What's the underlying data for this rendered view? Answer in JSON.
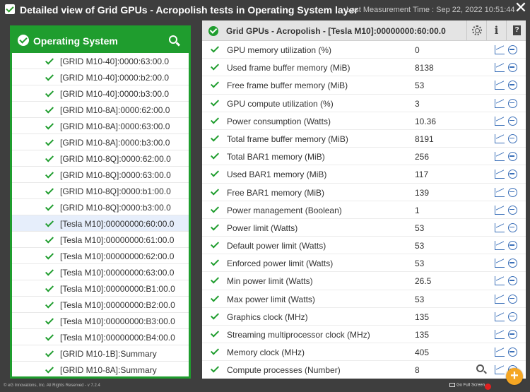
{
  "window": {
    "title": "Detailed view of Grid GPUs - Acropolish tests in Operating System layer",
    "last_measurement": "Last Measurement Time : Sep 22, 2022 10:51:44",
    "close_label": "✕"
  },
  "left_panel": {
    "title": "Operating System",
    "items": [
      {
        "label": "[GRID M10-40]:0000:63:00.0"
      },
      {
        "label": "[GRID M10-40]:0000:b2:00.0"
      },
      {
        "label": "[GRID M10-40]:0000:b3:00.0"
      },
      {
        "label": "[GRID M10-8A]:0000:62:00.0"
      },
      {
        "label": "[GRID M10-8A]:0000:63:00.0"
      },
      {
        "label": "[GRID M10-8A]:0000:b3:00.0"
      },
      {
        "label": "[GRID M10-8Q]:0000:62:00.0"
      },
      {
        "label": "[GRID M10-8Q]:0000:63:00.0"
      },
      {
        "label": "[GRID M10-8Q]:0000:b1:00.0"
      },
      {
        "label": "[GRID M10-8Q]:0000:b3:00.0"
      },
      {
        "label": "[Tesla M10]:00000000:60:00.0"
      },
      {
        "label": "[Tesla M10]:00000000:61:00.0"
      },
      {
        "label": "[Tesla M10]:00000000:62:00.0"
      },
      {
        "label": "[Tesla M10]:00000000:63:00.0"
      },
      {
        "label": "[Tesla M10]:00000000:B1:00.0"
      },
      {
        "label": "[Tesla M10]:00000000:B2:00.0"
      },
      {
        "label": "[Tesla M10]:00000000:B3:00.0"
      },
      {
        "label": "[Tesla M10]:00000000:B4:00.0"
      },
      {
        "label": "[GRID M10-1B]:Summary"
      },
      {
        "label": "[GRID M10-8A]:Summary"
      }
    ],
    "selected_index": 10
  },
  "right_panel": {
    "title": "Grid GPUs - Acropolish - [Tesla M10]:00000000:60:00.0",
    "info_label": "i",
    "help_label": "?",
    "rows": [
      {
        "name": "GPU memory utilization (%)",
        "value": "0"
      },
      {
        "name": "Used frame buffer memory (MiB)",
        "value": "8138"
      },
      {
        "name": "Free frame buffer memory (MiB)",
        "value": "53"
      },
      {
        "name": "GPU compute utilization (%)",
        "value": "3"
      },
      {
        "name": "Power consumption (Watts)",
        "value": "10.36"
      },
      {
        "name": "Total frame buffer memory (MiB)",
        "value": "8191"
      },
      {
        "name": "Total BAR1 memory (MiB)",
        "value": "256"
      },
      {
        "name": "Used BAR1 memory (MiB)",
        "value": "117"
      },
      {
        "name": "Free BAR1 memory (MiB)",
        "value": "139"
      },
      {
        "name": "Power management (Boolean)",
        "value": "1"
      },
      {
        "name": "Power limit (Watts)",
        "value": "53"
      },
      {
        "name": "Default power limit (Watts)",
        "value": "53"
      },
      {
        "name": "Enforced power limit (Watts)",
        "value": "53"
      },
      {
        "name": "Min power limit (Watts)",
        "value": "26.5"
      },
      {
        "name": "Max power limit (Watts)",
        "value": "53"
      },
      {
        "name": "Graphics clock (MHz)",
        "value": "135"
      },
      {
        "name": "Streaming multiprocessor clock (MHz)",
        "value": "135"
      },
      {
        "name": "Memory clock (MHz)",
        "value": "405"
      },
      {
        "name": "Compute processes (Number)",
        "value": "8"
      }
    ]
  },
  "footer": {
    "copyright": "© eG Innovations, Inc. All Rights Reserved - v 7.2.4",
    "full_screen": "Go Full Screen",
    "add_label": "+"
  },
  "colors": {
    "accent_green": "#1f9d2e",
    "link_blue": "#3a6fb8",
    "add_orange": "#f5a623"
  }
}
